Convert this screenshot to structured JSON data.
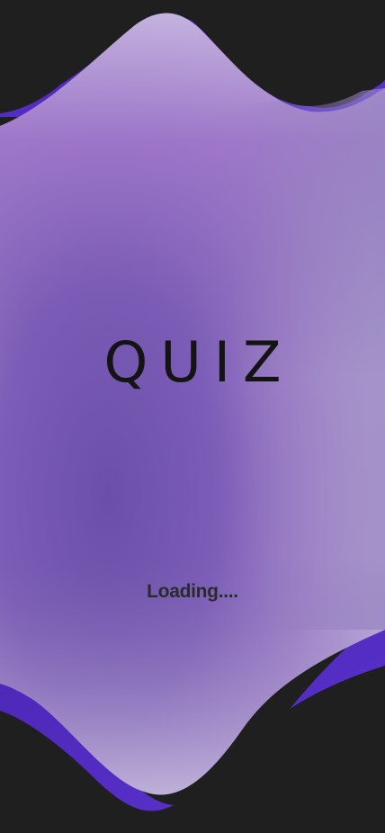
{
  "splash": {
    "logo_text": "QUIZ",
    "loading_text": "Loading...."
  },
  "colors": {
    "background": "#1f1f1f",
    "accent_purple": "#5b33c9",
    "panel_light": "#c0b0dc",
    "panel_mid": "#9a78c8",
    "panel_deep": "#6a4fa8"
  }
}
